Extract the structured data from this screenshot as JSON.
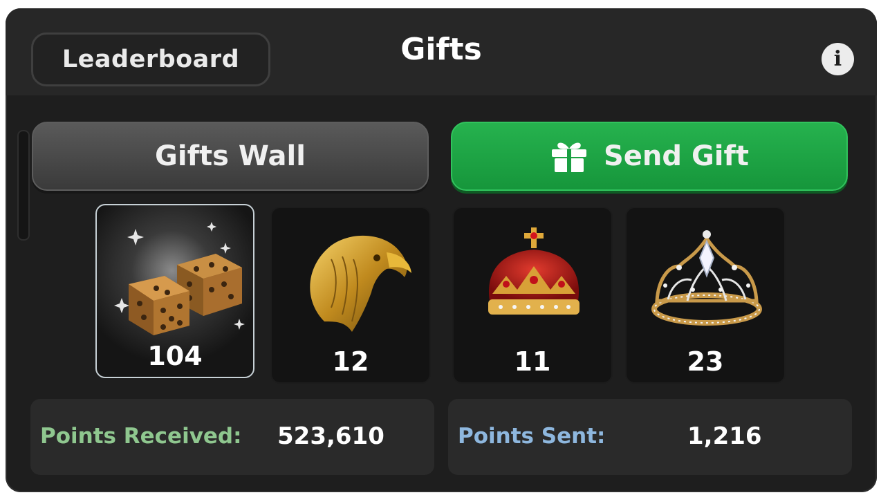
{
  "header": {
    "leaderboard_label": "Leaderboard",
    "title": "Gifts",
    "info_icon": "info-icon",
    "info_glyph": "i"
  },
  "tabs": {
    "wall_label": "Gifts Wall",
    "send_label": "Send Gift",
    "send_icon": "gift-box-icon"
  },
  "gifts": [
    {
      "name": "golden-dice",
      "icon": "dice-icon",
      "count": "104",
      "selected": true
    },
    {
      "name": "golden-eagle",
      "icon": "eagle-icon",
      "count": "12",
      "selected": false
    },
    {
      "name": "red-crown",
      "icon": "crown-icon",
      "count": "11",
      "selected": false
    },
    {
      "name": "diamond-tiara",
      "icon": "tiara-icon",
      "count": "23",
      "selected": false
    }
  ],
  "stats": {
    "received_label": "Points Received",
    "received_colon": ":",
    "received_value": "523,610",
    "sent_label": "Points Sent",
    "sent_colon": ":",
    "sent_value": "1,216"
  },
  "colors": {
    "received_label": "#8fc78f",
    "sent_label": "#8eb7de",
    "send_button": "#1ea546",
    "background": "#1e1e1e"
  }
}
